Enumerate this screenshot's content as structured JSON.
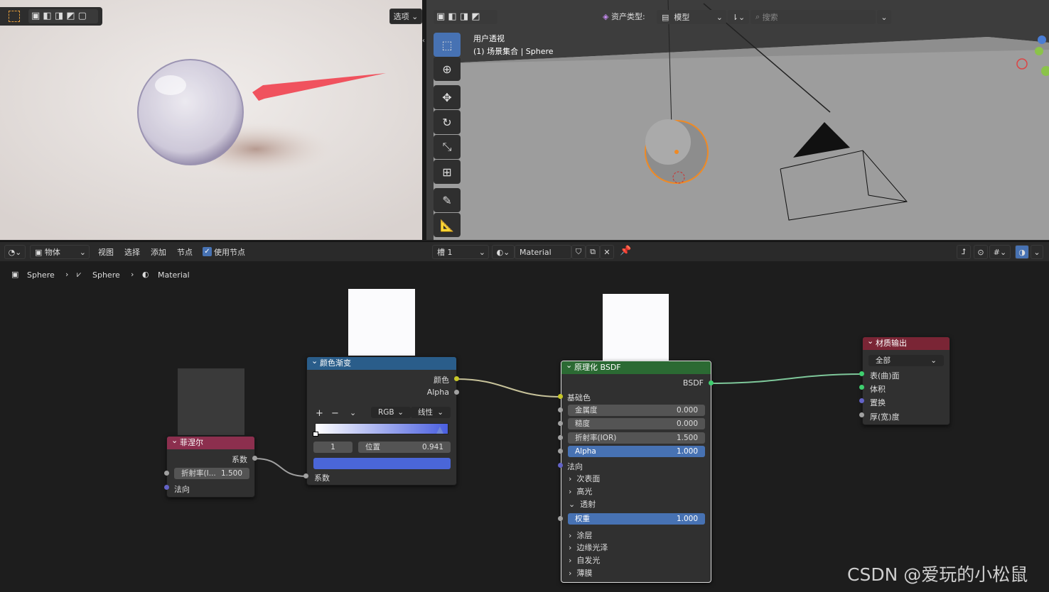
{
  "render_view": {
    "options_label": "选项"
  },
  "viewport": {
    "view_name": "用户透视",
    "collection_label": "(1) 场景集合 | Sphere",
    "asset_type_label": "资产类型:",
    "asset_type_value": "模型",
    "search_placeholder": "搜索"
  },
  "node_header": {
    "object_mode": "物体",
    "menu": [
      "视图",
      "选择",
      "添加",
      "节点"
    ],
    "use_nodes": "使用节点",
    "slot": "槽 1",
    "material_name": "Material"
  },
  "breadcrumb": [
    "Sphere",
    "Sphere",
    "Material"
  ],
  "nodes": {
    "fresnel": {
      "title": "菲涅尔",
      "out": "系数",
      "ior_label": "折射率(I...",
      "ior_value": "1.500",
      "normal": "法向",
      "color": "#8c2f4e"
    },
    "ramp": {
      "title": "颜色渐变",
      "out_color": "颜色",
      "out_alpha": "Alpha",
      "mode": "RGB",
      "interp": "线性",
      "stop_index": "1",
      "pos_label": "位置",
      "pos_value": "0.941",
      "in_fac": "系数",
      "color": "#2a5d8a"
    },
    "bsdf": {
      "title": "原理化 BSDF",
      "out": "BSDF",
      "base_color": "基础色",
      "fields": [
        {
          "label": "金属度",
          "value": "0.000"
        },
        {
          "label": "糙度",
          "value": "0.000"
        },
        {
          "label": "折射率(IOR)",
          "value": "1.500"
        },
        {
          "label": "Alpha",
          "value": "1.000"
        }
      ],
      "normal": "法向",
      "sections_a": [
        "次表面",
        "高光"
      ],
      "transmission": "透射",
      "weight_label": "权重",
      "weight_value": "1.000",
      "sections_b": [
        "涂层",
        "边缘光泽",
        "自发光",
        "薄膜"
      ],
      "color": "#2b6a33"
    },
    "output": {
      "title": "材质输出",
      "target": "全部",
      "inputs": [
        "表(曲)面",
        "体积",
        "置换",
        "厚(宽)度"
      ],
      "color": "#7a2535"
    }
  },
  "watermark": "CSDN @爱玩的小松鼠"
}
